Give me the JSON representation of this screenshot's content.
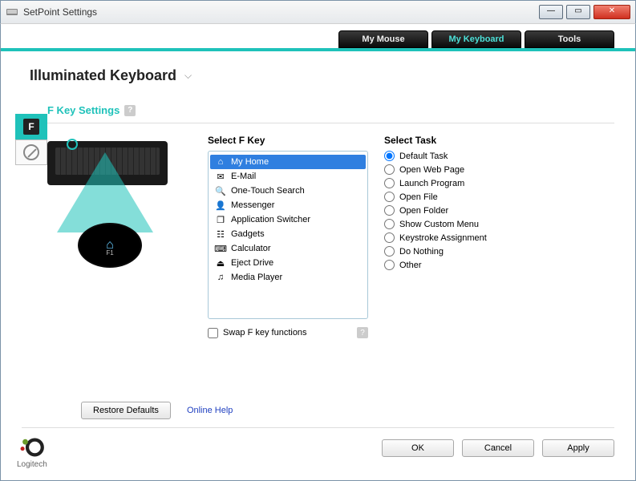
{
  "window": {
    "title": "SetPoint Settings"
  },
  "tabs": {
    "mouse": "My Mouse",
    "keyboard": "My Keyboard",
    "tools": "Tools",
    "active": "keyboard"
  },
  "device": {
    "name": "Illuminated Keyboard"
  },
  "section": {
    "title": "F Key Settings"
  },
  "fkeys": {
    "title": "Select F Key",
    "items": [
      {
        "icon": "home-icon",
        "glyph": "⌂",
        "label": "My Home",
        "selected": true
      },
      {
        "icon": "mail-icon",
        "glyph": "✉",
        "label": "E-Mail"
      },
      {
        "icon": "search-icon",
        "glyph": "🔍",
        "label": "One-Touch Search"
      },
      {
        "icon": "person-icon",
        "glyph": "👤",
        "label": "Messenger"
      },
      {
        "icon": "switcher-icon",
        "glyph": "❐",
        "label": "Application Switcher"
      },
      {
        "icon": "gadgets-icon",
        "glyph": "☷",
        "label": "Gadgets"
      },
      {
        "icon": "calc-icon",
        "glyph": "⌨",
        "label": "Calculator"
      },
      {
        "icon": "eject-icon",
        "glyph": "⏏",
        "label": "Eject Drive"
      },
      {
        "icon": "music-icon",
        "glyph": "♫",
        "label": "Media Player"
      }
    ],
    "swap_label": "Swap F key functions",
    "swap_checked": false
  },
  "tasks": {
    "title": "Select Task",
    "items": [
      {
        "label": "Default Task",
        "selected": true
      },
      {
        "label": "Open Web Page"
      },
      {
        "label": "Launch Program"
      },
      {
        "label": "Open File"
      },
      {
        "label": "Open Folder"
      },
      {
        "label": "Show Custom Menu"
      },
      {
        "label": "Keystroke Assignment"
      },
      {
        "label": "Do Nothing"
      },
      {
        "label": "Other"
      }
    ]
  },
  "zoom": {
    "key_label": "F1"
  },
  "footer": {
    "restore": "Restore Defaults",
    "online_help": "Online Help",
    "brand": "Logitech",
    "ok": "OK",
    "cancel": "Cancel",
    "apply": "Apply"
  }
}
